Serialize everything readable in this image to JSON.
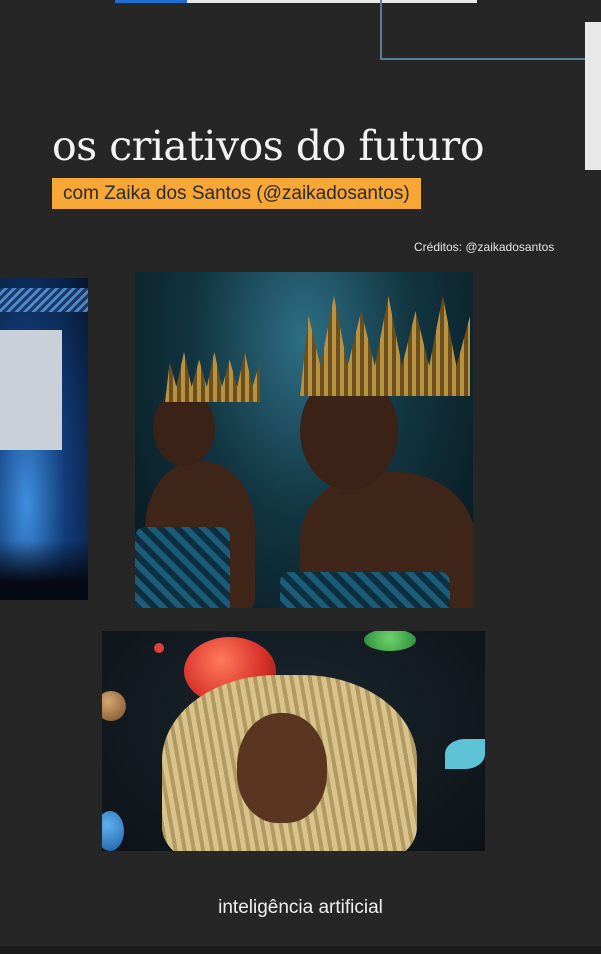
{
  "progress": {
    "fraction": 0.2
  },
  "title": "os criativos do futuro",
  "subtitle": "com Zaika dos Santos (@zaikadosantos)",
  "credits": "Créditos: @zaikadosantos",
  "caption": "inteligência artificial",
  "colors": {
    "background": "#262626",
    "subtitle_highlight": "#f6a735",
    "progress_fill": "#1f6fd1",
    "frame_line": "#5a7d8f"
  }
}
